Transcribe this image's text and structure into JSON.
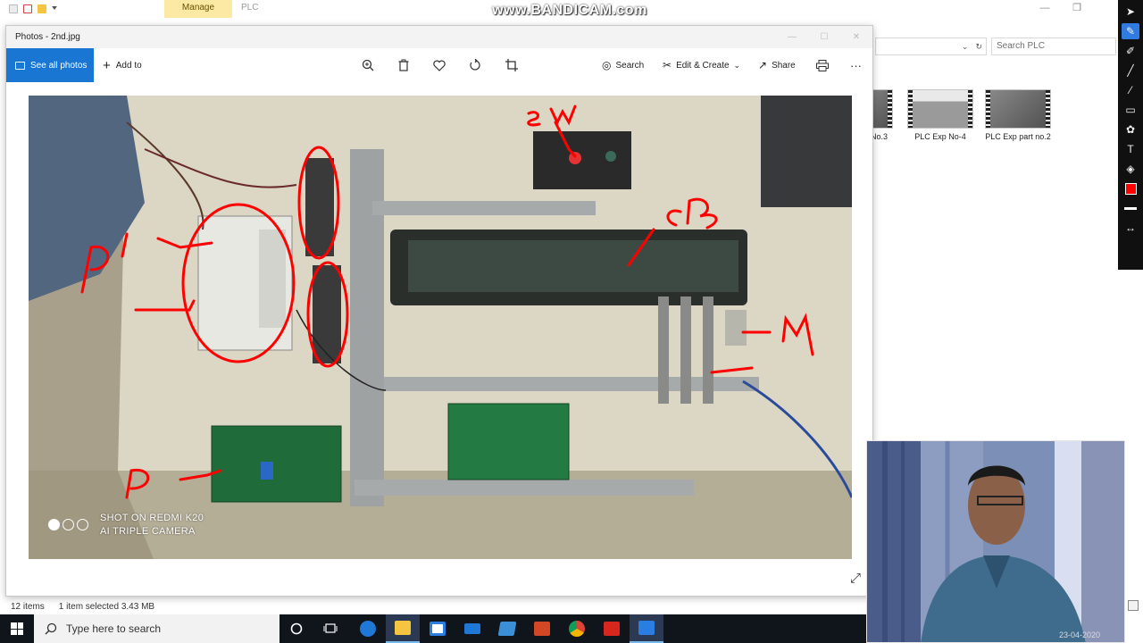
{
  "explorer": {
    "manage_tab": "Manage",
    "context_title": "PLC",
    "search_placeholder": "Search PLC",
    "status_items": "12 items",
    "status_selected": "1 item selected  3.43 MB",
    "thumbnails": [
      {
        "label": "No.3"
      },
      {
        "label": "PLC Exp No-4"
      },
      {
        "label": "PLC Exp part no.2"
      }
    ],
    "window_controls": {
      "minimize": "—",
      "restore": "❐"
    }
  },
  "watermark": "www.BANDICAM.com",
  "photos": {
    "title": "Photos - 2nd.jpg",
    "window_controls": {
      "minimize": "—",
      "maximize": "☐",
      "close": "✕"
    },
    "toolbar": {
      "see_all": "See all photos",
      "add_to": "Add to",
      "search": "Search",
      "edit_create": "Edit & Create",
      "share": "Share",
      "more": "···"
    },
    "photo": {
      "watermark_line1": "SHOT ON REDMI K20",
      "watermark_line2": "AI TRIPLE CAMERA",
      "annotations": [
        "PLC",
        "SW",
        "CB",
        "M",
        "P"
      ]
    }
  },
  "taskbar": {
    "search_placeholder": "Type here to search"
  },
  "webcam": {
    "timestamp": "23-04-2020"
  },
  "colors": {
    "accent_blue": "#1976d2",
    "annotation_red": "#ff0000",
    "manage_tab_bg": "#fbe9a4",
    "taskbar_bg": "#10141b"
  },
  "icons": {
    "zoom": "zoom-in-icon",
    "delete": "trash-icon",
    "favorite": "heart-icon",
    "rotate": "rotate-icon",
    "crop": "crop-icon",
    "print": "printer-icon"
  }
}
